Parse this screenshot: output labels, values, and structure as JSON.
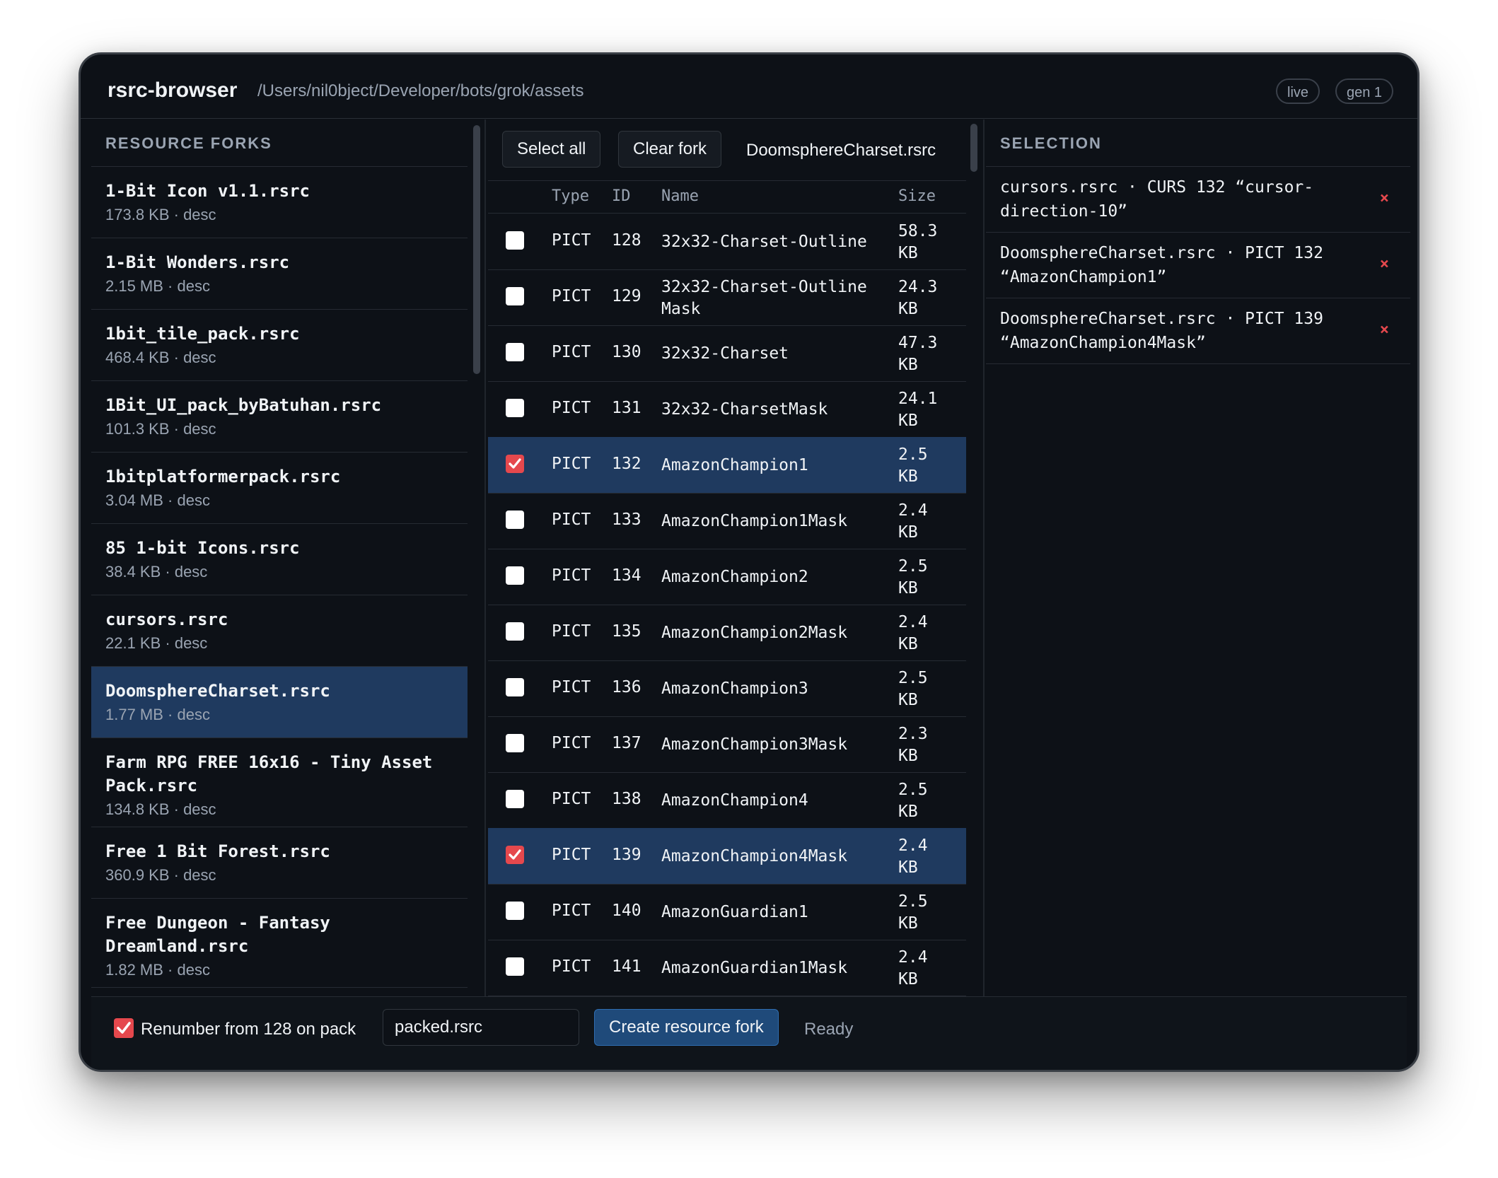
{
  "header": {
    "app_title": "rsrc-browser",
    "path": "/Users/nil0bject/Developer/bots/grok/assets",
    "badges": [
      "live",
      "gen 1"
    ]
  },
  "forks": {
    "heading": "RESOURCE FORKS",
    "items": [
      {
        "name": "1-Bit Icon v1.1.rsrc",
        "meta": "173.8 KB · desc"
      },
      {
        "name": "1-Bit Wonders.rsrc",
        "meta": "2.15 MB · desc"
      },
      {
        "name": "1bit_tile_pack.rsrc",
        "meta": "468.4 KB · desc"
      },
      {
        "name": "1Bit_UI_pack_byBatuhan.rsrc",
        "meta": "101.3 KB · desc"
      },
      {
        "name": "1bitplatformerpack.rsrc",
        "meta": "3.04 MB · desc"
      },
      {
        "name": "85 1-bit Icons.rsrc",
        "meta": "38.4 KB · desc"
      },
      {
        "name": "cursors.rsrc",
        "meta": "22.1 KB · desc"
      },
      {
        "name": "DoomsphereCharset.rsrc",
        "meta": "1.77 MB · desc",
        "selected": true
      },
      {
        "name": "Farm RPG FREE 16x16 - Tiny Asset Pack.rsrc",
        "meta": "134.8 KB · desc"
      },
      {
        "name": "Free 1 Bit Forest.rsrc",
        "meta": "360.9 KB · desc"
      },
      {
        "name": "Free Dungeon - Fantasy Dreamland.rsrc",
        "meta": "1.82 MB · desc"
      }
    ]
  },
  "toolbar": {
    "select_all": "Select all",
    "clear_fork": "Clear fork",
    "current_file": "DoomsphereCharset.rsrc"
  },
  "table": {
    "columns": [
      "Type",
      "ID",
      "Name",
      "Size"
    ],
    "rows": [
      {
        "type": "PICT",
        "id": "128",
        "name": "32x32-Charset-Outline",
        "size": "58.3 KB",
        "checked": false
      },
      {
        "type": "PICT",
        "id": "129",
        "name": "32x32-Charset-OutlineMask",
        "size": "24.3 KB",
        "checked": false
      },
      {
        "type": "PICT",
        "id": "130",
        "name": "32x32-Charset",
        "size": "47.3 KB",
        "checked": false
      },
      {
        "type": "PICT",
        "id": "131",
        "name": "32x32-CharsetMask",
        "size": "24.1 KB",
        "checked": false
      },
      {
        "type": "PICT",
        "id": "132",
        "name": "AmazonChampion1",
        "size": "2.5 KB",
        "checked": true
      },
      {
        "type": "PICT",
        "id": "133",
        "name": "AmazonChampion1Mask",
        "size": "2.4 KB",
        "checked": false
      },
      {
        "type": "PICT",
        "id": "134",
        "name": "AmazonChampion2",
        "size": "2.5 KB",
        "checked": false
      },
      {
        "type": "PICT",
        "id": "135",
        "name": "AmazonChampion2Mask",
        "size": "2.4 KB",
        "checked": false
      },
      {
        "type": "PICT",
        "id": "136",
        "name": "AmazonChampion3",
        "size": "2.5 KB",
        "checked": false
      },
      {
        "type": "PICT",
        "id": "137",
        "name": "AmazonChampion3Mask",
        "size": "2.3 KB",
        "checked": false
      },
      {
        "type": "PICT",
        "id": "138",
        "name": "AmazonChampion4",
        "size": "2.5 KB",
        "checked": false
      },
      {
        "type": "PICT",
        "id": "139",
        "name": "AmazonChampion4Mask",
        "size": "2.4 KB",
        "checked": true
      },
      {
        "type": "PICT",
        "id": "140",
        "name": "AmazonGuardian1",
        "size": "2.5 KB",
        "checked": false
      },
      {
        "type": "PICT",
        "id": "141",
        "name": "AmazonGuardian1Mask",
        "size": "2.4 KB",
        "checked": false
      }
    ]
  },
  "selection": {
    "heading": "SELECTION",
    "remove_glyph": "×",
    "items": [
      "cursors.rsrc · CURS 132 “cursor-direction-10”",
      "DoomsphereCharset.rsrc · PICT 132 “AmazonChampion1”",
      "DoomsphereCharset.rsrc · PICT 139 “AmazonChampion4Mask”"
    ]
  },
  "footer": {
    "renumber_label": "Renumber from 128 on pack",
    "renumber_checked": true,
    "filename_value": "packed.rsrc",
    "create_button": "Create resource fork",
    "status": "Ready"
  },
  "colors": {
    "window_bg": "#0d1117",
    "selection_bg": "#1f3a5f",
    "accent_red": "#e5484d",
    "primary_button": "#1f4a7a"
  },
  "icons": [
    "checkmark-icon",
    "remove-x-icon"
  ]
}
